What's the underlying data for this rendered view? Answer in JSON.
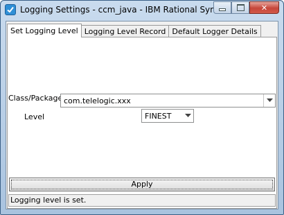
{
  "window": {
    "title": "Logging Settings - ccm_java - IBM Rational Syner...",
    "icon": "app-check-icon",
    "controls": [
      "minimize-icon",
      "maximize-icon",
      "close-icon"
    ]
  },
  "tabs": [
    {
      "label": "Set Logging Level",
      "active": true
    },
    {
      "label": "Logging Level Record",
      "active": false
    },
    {
      "label": "Default Logger Details",
      "active": false
    }
  ],
  "form": {
    "class_package_label": "Class/Package",
    "class_package_value": "com.telelogic.xxx",
    "level_label": "Level",
    "level_value": "FINEST"
  },
  "apply_label": "Apply",
  "status_text": "Logging level is set.",
  "colors": {
    "titlebar": "#b8cfe8",
    "close_button": "#c6463a",
    "panel_background": "#ffffff"
  }
}
